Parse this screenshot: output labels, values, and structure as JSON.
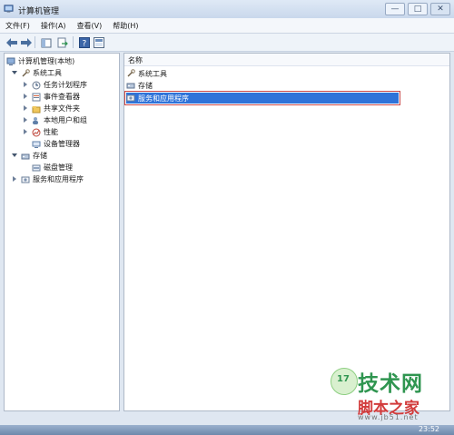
{
  "window": {
    "title": "计算机管理"
  },
  "menu": {
    "items": [
      "文件(F)",
      "操作(A)",
      "查看(V)",
      "帮助(H)"
    ]
  },
  "toolbar": {
    "icons": [
      "back-arrow-icon",
      "forward-arrow-icon",
      "up-folder-icon",
      "export-icon",
      "help-icon",
      "properties-icon"
    ]
  },
  "tree": {
    "root": "计算机管理(本地)",
    "items": [
      {
        "label": "系统工具",
        "level": 1,
        "expanded": true
      },
      {
        "label": "任务计划程序",
        "level": 2
      },
      {
        "label": "事件查看器",
        "level": 2
      },
      {
        "label": "共享文件夹",
        "level": 2
      },
      {
        "label": "本地用户和组",
        "level": 2
      },
      {
        "label": "性能",
        "level": 2
      },
      {
        "label": "设备管理器",
        "level": 2
      },
      {
        "label": "存储",
        "level": 1,
        "expanded": true
      },
      {
        "label": "磁盘管理",
        "level": 2
      },
      {
        "label": "服务和应用程序",
        "level": 1
      }
    ]
  },
  "list": {
    "column": "名称",
    "items": [
      {
        "label": "系统工具"
      },
      {
        "label": "存储"
      },
      {
        "label": "服务和应用程序",
        "selected": true
      }
    ]
  },
  "taskbar": {
    "time": "23:52"
  },
  "watermark": {
    "main": "技术网",
    "sub": "脚本之家",
    "url": "www.jb51.net"
  },
  "colors": {
    "selection": "#2f73d9",
    "selection_outline": "#c84646",
    "pane_bg": "#ffffff",
    "chrome_bg": "#dfe7f1"
  }
}
